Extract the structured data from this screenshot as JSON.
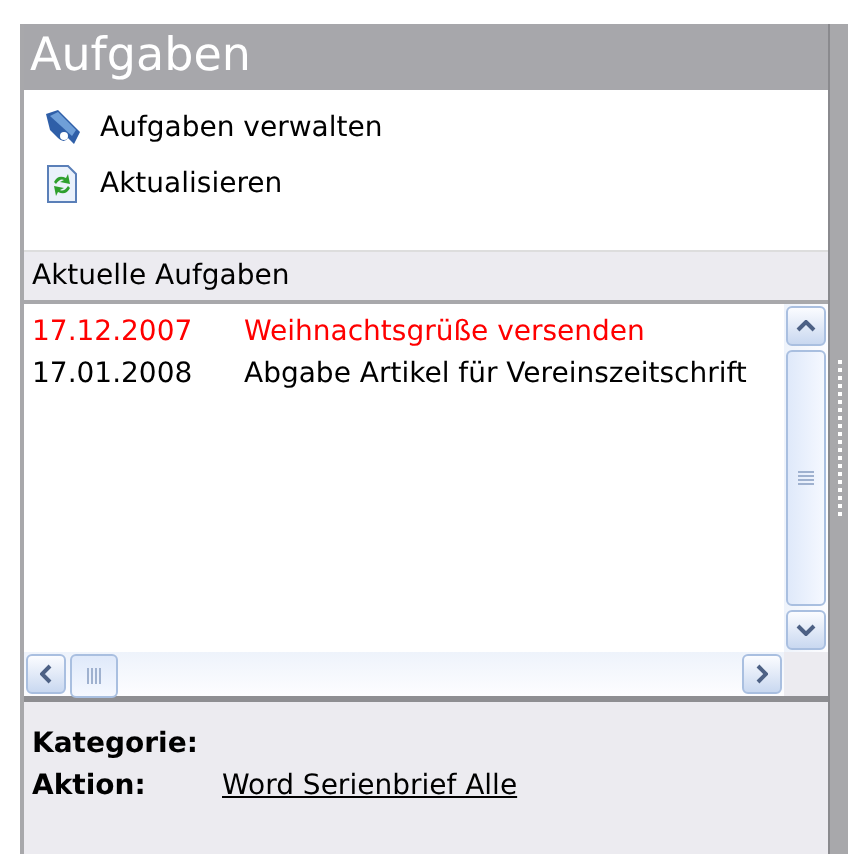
{
  "panel": {
    "title": "Aufgaben"
  },
  "actions": [
    {
      "kind": "manage",
      "label": "Aufgaben verwalten"
    },
    {
      "kind": "refresh",
      "label": "Aktualisieren"
    }
  ],
  "list": {
    "title": "Aktuelle Aufgaben",
    "rows": [
      {
        "date": "17.12.2007",
        "subject": "Weihnachtsgrüße versenden",
        "color": "#ff0000"
      },
      {
        "date": "17.01.2008",
        "subject": "Abgabe Artikel für Vereinszeitschrift",
        "color": "#000000"
      }
    ]
  },
  "details": [
    {
      "label": "Kategorie:",
      "kind": "text"
    },
    {
      "label": "Aktion:",
      "value": "Word Serienbrief Alle",
      "kind": "link"
    }
  ]
}
